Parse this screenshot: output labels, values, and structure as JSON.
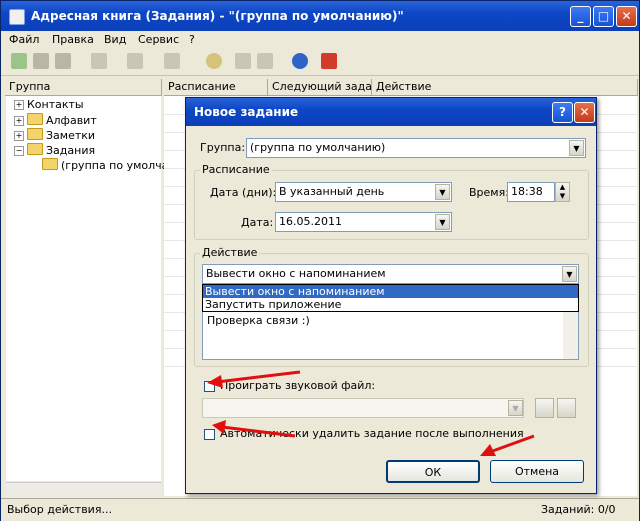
{
  "window": {
    "title": "Адресная книга (Задания) - \"(группа по умолчанию)\"",
    "min": "_",
    "max": "□",
    "close": "✕"
  },
  "menu": [
    "Файл",
    "Правка",
    "Вид",
    "Сервис",
    "?"
  ],
  "columns": {
    "group": "Группа",
    "schedule": "Расписание",
    "next": "Следующий зада...",
    "action": "Действие"
  },
  "tree": {
    "contacts": "Контакты",
    "alphabet": "Алфавит",
    "notes": "Заметки",
    "tasks": "Задания",
    "default_group": "(группа по умолчан"
  },
  "status": {
    "left": "Выбор действия...",
    "right": "Заданий: 0/0"
  },
  "dialog": {
    "title": "Новое задание",
    "help": "?",
    "close": "✕",
    "group_label": "Группа:",
    "group_value": "(группа по умолчанию)",
    "schedule_label": "Расписание",
    "date_days_label": "Дата (дни):",
    "date_days_value": "В указанный день",
    "time_label": "Время:",
    "time_value": "18:38",
    "date_label": "Дата:",
    "date_value": "16.05.2011",
    "action_label": "Действие",
    "action_value": "Вывести окно с напоминанием",
    "action_options": [
      "Вывести окно с напоминанием",
      "Запустить приложение"
    ],
    "message_text": "Проверка связи :)",
    "play_sound_label": "Проиграть звуковой файл:",
    "auto_delete_label": "Автоматически удалить задание после выполнения",
    "ok": "ОК",
    "cancel": "Отмена"
  },
  "colors": {
    "titlebar": "#0d47c6",
    "selection": "#316ac5",
    "annotation_arrow": "#e01010"
  }
}
